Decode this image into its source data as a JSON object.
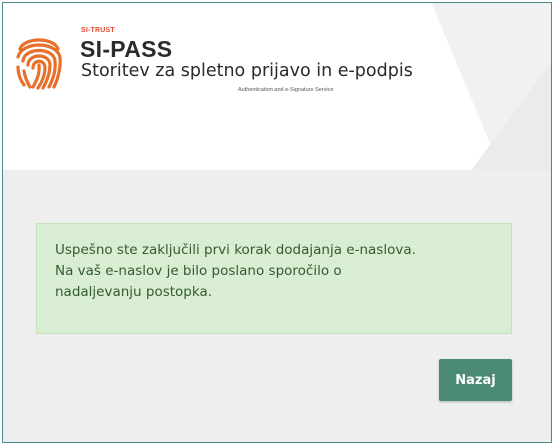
{
  "header": {
    "brand_small": "SI-TRUST",
    "title": "SI-PASS",
    "subtitle": "Storitev za spletno prijavo in e-podpis",
    "tagline": "Authentication and e-Signature Service",
    "logo_icon": "fingerprint-icon"
  },
  "message": {
    "lines": [
      "Uspešno ste zaključili prvi korak dodajanja e-naslova.",
      "Na vaš e-naslov je bilo poslano sporočilo o",
      "nadaljevanju postopka."
    ]
  },
  "actions": {
    "back_label": "Nazaj"
  },
  "colors": {
    "brand_orange": "#e8702a",
    "brand_red": "#e0492f",
    "alert_bg": "#d9edd2",
    "alert_text": "#355a32",
    "button_bg": "#4b8a75",
    "frame_border": "#4f8a8b",
    "page_bg": "#eeeeee"
  }
}
